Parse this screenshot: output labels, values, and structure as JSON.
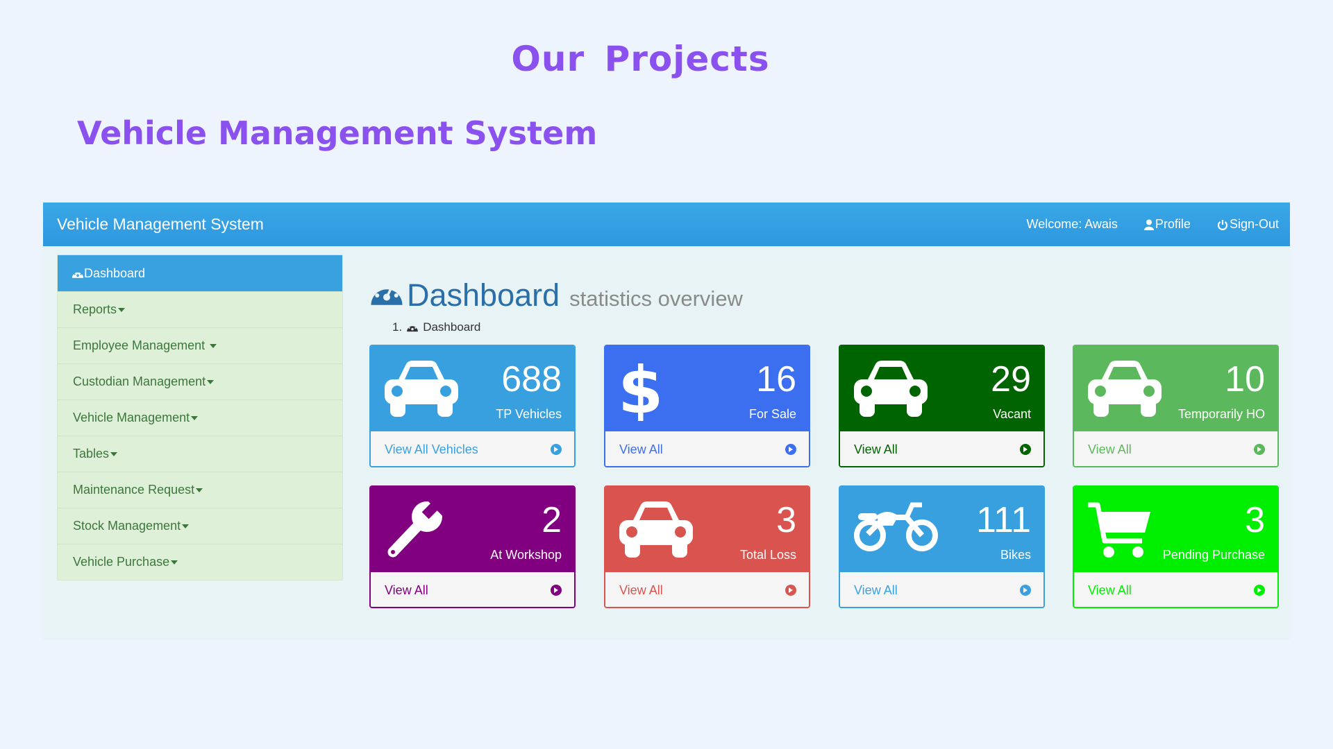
{
  "slide": {
    "title": "Our  Projects",
    "subtitle": "Vehicle Management System"
  },
  "app": {
    "brand": "Vehicle Management System",
    "topnav": {
      "welcome": "Welcome: Awais",
      "profile": "Profile",
      "signout": "Sign-Out"
    },
    "sidebar": [
      {
        "label": "Dashboard"
      },
      {
        "label": "Reports"
      },
      {
        "label": "Employee Management "
      },
      {
        "label": "Custodian Management"
      },
      {
        "label": "Vehicle Management"
      },
      {
        "label": "Tables"
      },
      {
        "label": "Maintenance Request"
      },
      {
        "label": "Stock Management"
      },
      {
        "label": "Vehicle Purchase"
      }
    ],
    "heading": {
      "title": "Dashboard",
      "subtitle": "statistics overview"
    },
    "breadcrumb": {
      "index": "1.",
      "label": "Dashboard"
    },
    "cards": [
      {
        "value": "688",
        "label": "TP Vehicles",
        "link": "View All Vehicles",
        "icon": "car-icon",
        "color": "#39a0e0"
      },
      {
        "value": "16",
        "label": "For Sale",
        "link": "View All",
        "icon": "dollar-icon",
        "color": "#3b6fef"
      },
      {
        "value": "29",
        "label": "Vacant",
        "link": "View All",
        "icon": "car-icon",
        "color": "#006400"
      },
      {
        "value": "10",
        "label": "Temporarily HO",
        "link": "View All",
        "icon": "car-icon",
        "color": "#5cb85c"
      },
      {
        "value": "2",
        "label": "At Workshop",
        "link": "View All",
        "icon": "wrench-icon",
        "color": "#800080"
      },
      {
        "value": "3",
        "label": "Total Loss",
        "link": "View All",
        "icon": "car-icon",
        "color": "#d9534f"
      },
      {
        "value": "111",
        "label": "Bikes",
        "link": "View All",
        "icon": "motorcycle-icon",
        "color": "#39a0e0"
      },
      {
        "value": "3",
        "label": "Pending Purchase",
        "link": "View All",
        "icon": "shopping-cart-icon",
        "color": "#00ee00"
      }
    ]
  }
}
